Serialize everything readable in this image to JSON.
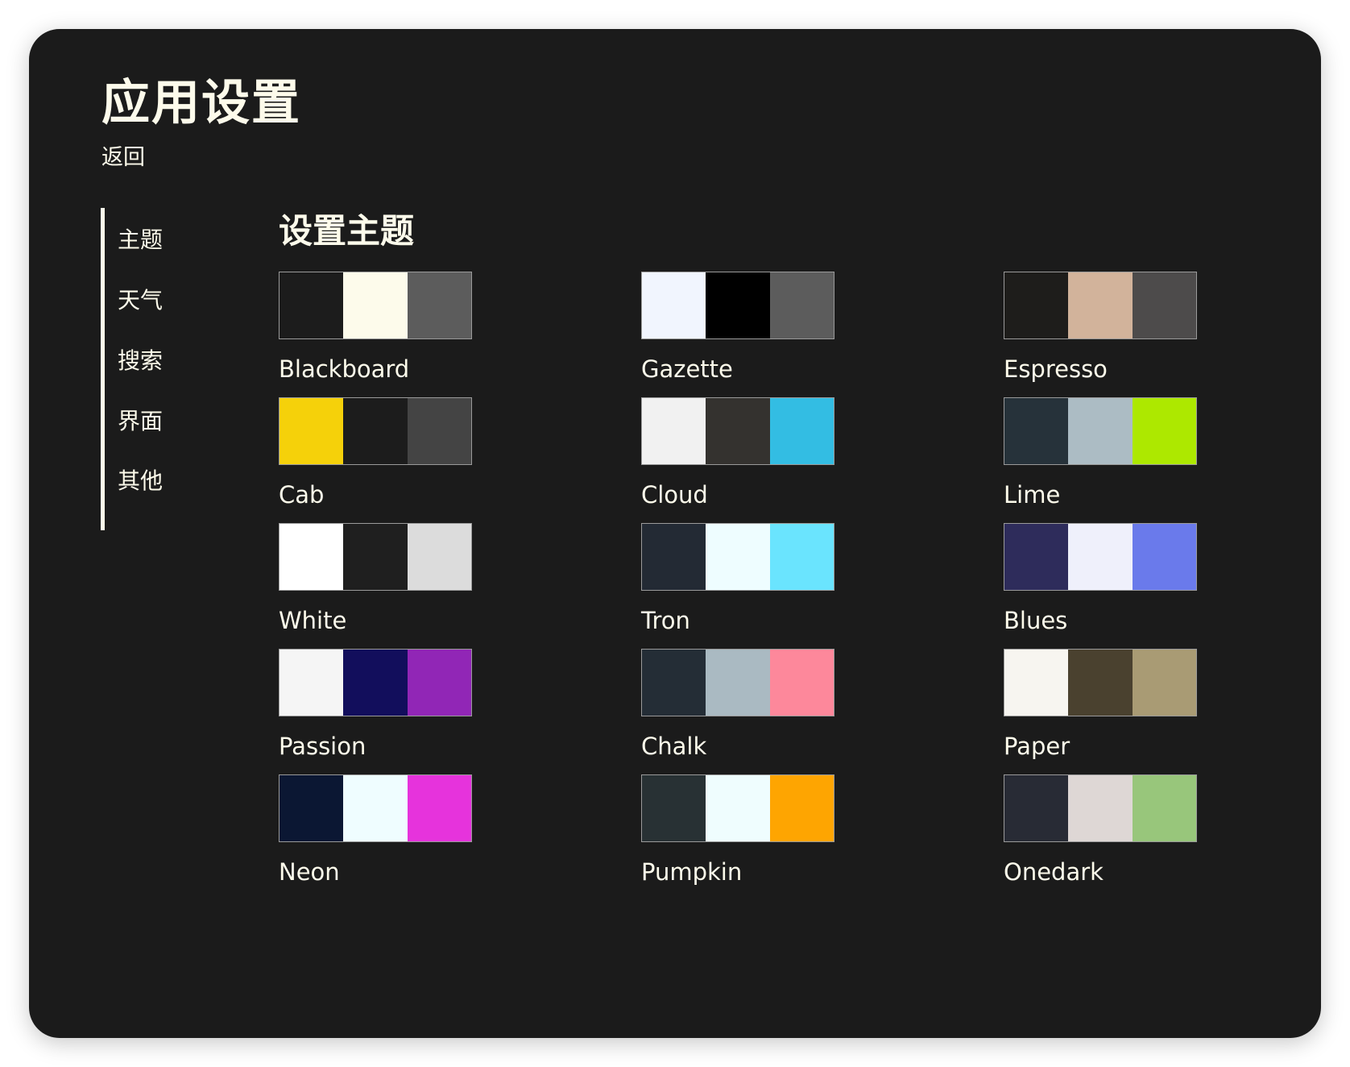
{
  "app": {
    "title": "应用设置",
    "back_label": "返回"
  },
  "sidebar": {
    "items": [
      {
        "label": "主题"
      },
      {
        "label": "天气"
      },
      {
        "label": "搜索"
      },
      {
        "label": "界面"
      },
      {
        "label": "其他"
      }
    ],
    "active": "主题"
  },
  "main": {
    "title": "设置主题",
    "themes": [
      {
        "name": "Blackboard",
        "colors": [
          "#1c1c1c",
          "#fdfbeb",
          "#5c5c5c"
        ]
      },
      {
        "name": "Gazette",
        "colors": [
          "#f1f5fe",
          "#000000",
          "#5c5c5c"
        ]
      },
      {
        "name": "Espresso",
        "colors": [
          "#1e1d1b",
          "#d2b39b",
          "#4d4b4b"
        ]
      },
      {
        "name": "Cab",
        "colors": [
          "#f5d10a",
          "#1c1c1c",
          "#444444"
        ]
      },
      {
        "name": "Cloud",
        "colors": [
          "#f1f1f1",
          "#34322f",
          "#33bde3"
        ]
      },
      {
        "name": "Lime",
        "colors": [
          "#26323a",
          "#acbcc4",
          "#ade800"
        ]
      },
      {
        "name": "White",
        "colors": [
          "#ffffff",
          "#1f1f1f",
          "#dcdcdc"
        ]
      },
      {
        "name": "Tron",
        "colors": [
          "#232a34",
          "#eefdff",
          "#6ae4fe"
        ]
      },
      {
        "name": "Blues",
        "colors": [
          "#2e2c5b",
          "#eff0fb",
          "#6a7aeb"
        ]
      },
      {
        "name": "Passion",
        "colors": [
          "#f5f5f5",
          "#120e5c",
          "#9126b6"
        ]
      },
      {
        "name": "Chalk",
        "colors": [
          "#242d36",
          "#aabac2",
          "#fd889b"
        ]
      },
      {
        "name": "Paper",
        "colors": [
          "#f7f5f0",
          "#4a412f",
          "#a99b74"
        ]
      },
      {
        "name": "Neon",
        "colors": [
          "#0b1733",
          "#effdff",
          "#e633dc"
        ]
      },
      {
        "name": "Pumpkin",
        "colors": [
          "#283134",
          "#effdfe",
          "#fea501"
        ]
      },
      {
        "name": "Onedark",
        "colors": [
          "#282b35",
          "#ded7d5",
          "#98c67b"
        ]
      }
    ]
  }
}
